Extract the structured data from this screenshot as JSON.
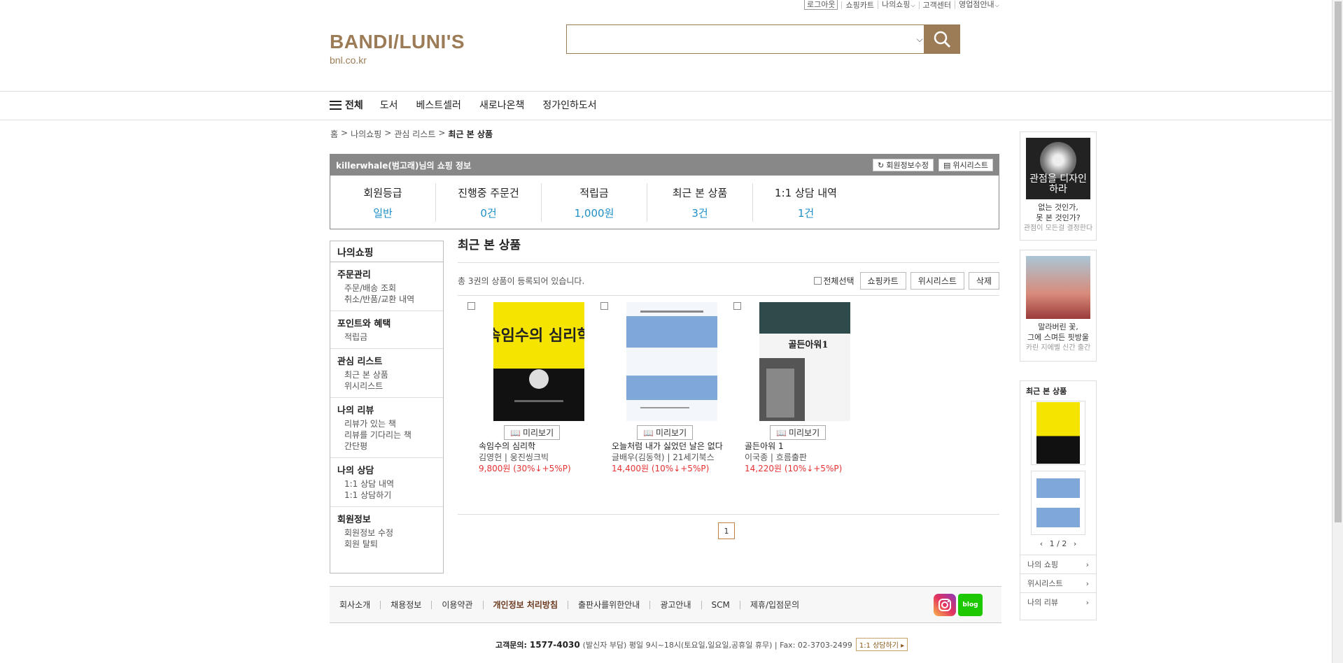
{
  "util": [
    "로그아웃",
    "쇼핑카트",
    "나의쇼핑",
    "고객센터",
    "영업점안내"
  ],
  "logo": {
    "name": "BANDI/LUNI'S",
    "sub": "bnl.co.kr"
  },
  "search": {
    "placeholder": "",
    "value": ""
  },
  "gnb": {
    "all": "전체",
    "items": [
      "도서",
      "베스트셀러",
      "새로나온책",
      "정가인하도서"
    ]
  },
  "breadcrumb": [
    "홈",
    ">",
    "나의쇼핑",
    ">",
    "관심 리스트",
    ">",
    "최근 본 상품"
  ],
  "member": {
    "title": "killerwhale(범고래)님의 쇼핑 정보",
    "edit": "회원정보수정",
    "wish": "위시리스트",
    "stats": [
      {
        "label": "회원등급",
        "value": "일반"
      },
      {
        "label": "진행중 주문건",
        "value": "0건"
      },
      {
        "label": "적립금",
        "value": "1,000원"
      },
      {
        "label": "최근 본 상품",
        "value": "3건"
      },
      {
        "label": "1:1 상담 내역",
        "value": "1건"
      }
    ]
  },
  "side": {
    "title": "나의쇼핑",
    "groups": [
      {
        "title": "주문관리",
        "items": [
          "주문/배송 조회",
          "취소/반품/교환 내역"
        ]
      },
      {
        "title": "포인트와 혜택",
        "items": [
          "적립금"
        ]
      },
      {
        "title": "관심 리스트",
        "items": [
          "최근 본 상품",
          "위시리스트"
        ]
      },
      {
        "title": "나의 리뷰",
        "items": [
          "리뷰가 있는 책",
          "리뷰를 기다리는 책",
          "간단평"
        ]
      },
      {
        "title": "나의 상담",
        "items": [
          "1:1 상담 내역",
          "1:1 상담하기"
        ]
      },
      {
        "title": "회원정보",
        "items": [
          "회원정보 수정",
          "회원 탈퇴"
        ]
      }
    ]
  },
  "main": {
    "title": "최근 본 상품",
    "count": "총 3권의 상품이 등록되어 있습니다.",
    "select_all": "전체선택",
    "cart": "쇼핑카트",
    "wishlist": "위시리스트",
    "delete": "삭제",
    "preview": "미리보기",
    "page": "1"
  },
  "books": [
    {
      "title": "속임수의 심리학",
      "author": "김영헌 | 웅진씽크빅",
      "price": "9,800원 (30%↓+5%P)",
      "cover_text": "속임수의 심리학"
    },
    {
      "title": "오늘처럼 내가 싫었던 날은 없다",
      "author": "글배우(김동혁) | 21세기북스",
      "price": "14,400원 (10%↓+5%P)",
      "cover_text": ""
    },
    {
      "title": "골든아워 1",
      "author": "이국종 | 흐름출판",
      "price": "14,220원 (10%↓+5%P)",
      "cover_text": "골든아워1"
    }
  ],
  "rail": {
    "ad1_img": "관점을 디자인하라",
    "ad1": [
      "없는 것인가,",
      "못 본 것인가?"
    ],
    "ad1_sub": "관점이 모든걸 결정한다",
    "ad2": [
      "말라버린 꽃,",
      "그에 스며든 핏방울"
    ],
    "ad2_sub": "카린 지에벨 신간 출간",
    "recent_title": "최근 본 상품",
    "pager": "1 / 2",
    "links": [
      "나의 쇼핑",
      "위시리스트",
      "나의 리뷰"
    ]
  },
  "footer": {
    "links": [
      "회사소개",
      "채용정보",
      "이용약관",
      "개인정보 처리방침",
      "출판사를위한안내",
      "광고안내",
      "SCM",
      "제휴/입점문의"
    ],
    "cs_label": "고객문의:",
    "cs_phone": "1577-4030",
    "cs_info": "(발신자 부담) 평일 9시~18시(토요일,일요일,공휴일 휴무) | Fax: 02-3703-2499",
    "cs_btn": "1:1 상담하기"
  }
}
